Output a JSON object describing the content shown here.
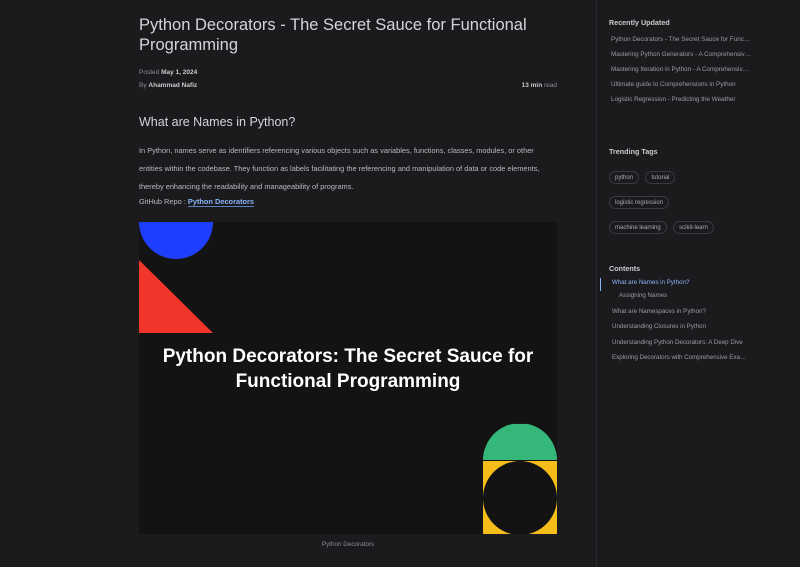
{
  "article": {
    "title": "Python Decorators - The Secret Sauce for Functional Programming",
    "posted_label": "Posted",
    "posted_date": "May 1, 2024",
    "by_label": "By",
    "author": "Ahammad Nafiz",
    "read_time": "13 min",
    "read_label": "read",
    "section_heading": "What are Names in Python?",
    "paragraph": "In Python, names serve as identifiers referencing various objects such as variables, functions, classes, modules, or other entities within the codebase. They function as labels facilitating the referencing and manipulation of data or code elements, thereby enhancing the readability and manageability of programs.",
    "repo_label": "GitHub Repo :",
    "repo_link": "Python Decorators",
    "hero_title": "Python Decorators: The Secret Sauce for Functional Programming",
    "caption": "Python Decorators"
  },
  "sidebar": {
    "recent_heading": "Recently Updated",
    "recent_items": [
      "Python Decorators - The Secret Sauce for Functional Programming",
      "Mastering Python Generators - A Comprehensive Guide",
      "Mastering Iteration in Python - A Comprehensive Guide",
      "Ultimate guide to Comprehensions in Python",
      "Logistic Regression - Predicting the Weather"
    ],
    "tags_heading": "Trending Tags",
    "tags": [
      "python",
      "tutorial",
      "logistic regression",
      "machine learning",
      "scikit-learn"
    ],
    "toc_heading": "Contents",
    "toc_items": [
      "What are Names in Python?",
      "Assigning Names",
      "What are Namespaces in Python?",
      "Understanding Closures in Python",
      "Understanding Python Decorators: A Deep Dive",
      "Exploring Decorators with Comprehensive Examples"
    ]
  },
  "colors": {
    "background": "#1b1b1e",
    "link": "#8ab4f8",
    "hero_blue": "#1f3fff",
    "hero_red": "#f0352a",
    "hero_green": "#35b77a",
    "hero_yellow": "#f4bd1a"
  }
}
